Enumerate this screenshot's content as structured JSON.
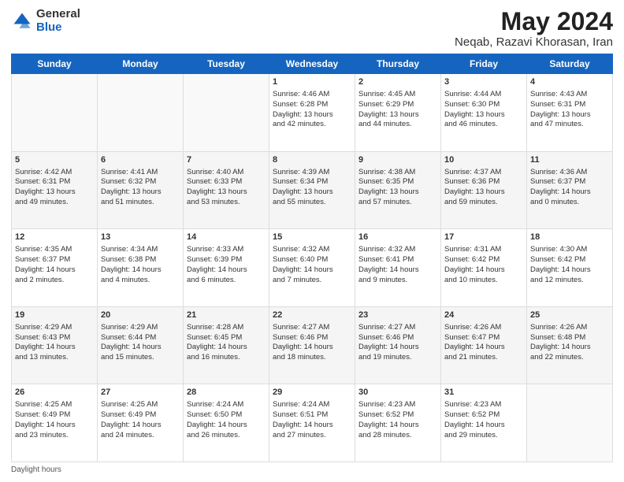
{
  "logo": {
    "general": "General",
    "blue": "Blue"
  },
  "title": "May 2024",
  "subtitle": "Neqab, Razavi Khorasan, Iran",
  "days_of_week": [
    "Sunday",
    "Monday",
    "Tuesday",
    "Wednesday",
    "Thursday",
    "Friday",
    "Saturday"
  ],
  "footer_label": "Daylight hours",
  "weeks": [
    [
      {
        "day": "",
        "info": ""
      },
      {
        "day": "",
        "info": ""
      },
      {
        "day": "",
        "info": ""
      },
      {
        "day": "1",
        "info": "Sunrise: 4:46 AM\nSunset: 6:28 PM\nDaylight: 13 hours\nand 42 minutes."
      },
      {
        "day": "2",
        "info": "Sunrise: 4:45 AM\nSunset: 6:29 PM\nDaylight: 13 hours\nand 44 minutes."
      },
      {
        "day": "3",
        "info": "Sunrise: 4:44 AM\nSunset: 6:30 PM\nDaylight: 13 hours\nand 46 minutes."
      },
      {
        "day": "4",
        "info": "Sunrise: 4:43 AM\nSunset: 6:31 PM\nDaylight: 13 hours\nand 47 minutes."
      }
    ],
    [
      {
        "day": "5",
        "info": "Sunrise: 4:42 AM\nSunset: 6:31 PM\nDaylight: 13 hours\nand 49 minutes."
      },
      {
        "day": "6",
        "info": "Sunrise: 4:41 AM\nSunset: 6:32 PM\nDaylight: 13 hours\nand 51 minutes."
      },
      {
        "day": "7",
        "info": "Sunrise: 4:40 AM\nSunset: 6:33 PM\nDaylight: 13 hours\nand 53 minutes."
      },
      {
        "day": "8",
        "info": "Sunrise: 4:39 AM\nSunset: 6:34 PM\nDaylight: 13 hours\nand 55 minutes."
      },
      {
        "day": "9",
        "info": "Sunrise: 4:38 AM\nSunset: 6:35 PM\nDaylight: 13 hours\nand 57 minutes."
      },
      {
        "day": "10",
        "info": "Sunrise: 4:37 AM\nSunset: 6:36 PM\nDaylight: 13 hours\nand 59 minutes."
      },
      {
        "day": "11",
        "info": "Sunrise: 4:36 AM\nSunset: 6:37 PM\nDaylight: 14 hours\nand 0 minutes."
      }
    ],
    [
      {
        "day": "12",
        "info": "Sunrise: 4:35 AM\nSunset: 6:37 PM\nDaylight: 14 hours\nand 2 minutes."
      },
      {
        "day": "13",
        "info": "Sunrise: 4:34 AM\nSunset: 6:38 PM\nDaylight: 14 hours\nand 4 minutes."
      },
      {
        "day": "14",
        "info": "Sunrise: 4:33 AM\nSunset: 6:39 PM\nDaylight: 14 hours\nand 6 minutes."
      },
      {
        "day": "15",
        "info": "Sunrise: 4:32 AM\nSunset: 6:40 PM\nDaylight: 14 hours\nand 7 minutes."
      },
      {
        "day": "16",
        "info": "Sunrise: 4:32 AM\nSunset: 6:41 PM\nDaylight: 14 hours\nand 9 minutes."
      },
      {
        "day": "17",
        "info": "Sunrise: 4:31 AM\nSunset: 6:42 PM\nDaylight: 14 hours\nand 10 minutes."
      },
      {
        "day": "18",
        "info": "Sunrise: 4:30 AM\nSunset: 6:42 PM\nDaylight: 14 hours\nand 12 minutes."
      }
    ],
    [
      {
        "day": "19",
        "info": "Sunrise: 4:29 AM\nSunset: 6:43 PM\nDaylight: 14 hours\nand 13 minutes."
      },
      {
        "day": "20",
        "info": "Sunrise: 4:29 AM\nSunset: 6:44 PM\nDaylight: 14 hours\nand 15 minutes."
      },
      {
        "day": "21",
        "info": "Sunrise: 4:28 AM\nSunset: 6:45 PM\nDaylight: 14 hours\nand 16 minutes."
      },
      {
        "day": "22",
        "info": "Sunrise: 4:27 AM\nSunset: 6:46 PM\nDaylight: 14 hours\nand 18 minutes."
      },
      {
        "day": "23",
        "info": "Sunrise: 4:27 AM\nSunset: 6:46 PM\nDaylight: 14 hours\nand 19 minutes."
      },
      {
        "day": "24",
        "info": "Sunrise: 4:26 AM\nSunset: 6:47 PM\nDaylight: 14 hours\nand 21 minutes."
      },
      {
        "day": "25",
        "info": "Sunrise: 4:26 AM\nSunset: 6:48 PM\nDaylight: 14 hours\nand 22 minutes."
      }
    ],
    [
      {
        "day": "26",
        "info": "Sunrise: 4:25 AM\nSunset: 6:49 PM\nDaylight: 14 hours\nand 23 minutes."
      },
      {
        "day": "27",
        "info": "Sunrise: 4:25 AM\nSunset: 6:49 PM\nDaylight: 14 hours\nand 24 minutes."
      },
      {
        "day": "28",
        "info": "Sunrise: 4:24 AM\nSunset: 6:50 PM\nDaylight: 14 hours\nand 26 minutes."
      },
      {
        "day": "29",
        "info": "Sunrise: 4:24 AM\nSunset: 6:51 PM\nDaylight: 14 hours\nand 27 minutes."
      },
      {
        "day": "30",
        "info": "Sunrise: 4:23 AM\nSunset: 6:52 PM\nDaylight: 14 hours\nand 28 minutes."
      },
      {
        "day": "31",
        "info": "Sunrise: 4:23 AM\nSunset: 6:52 PM\nDaylight: 14 hours\nand 29 minutes."
      },
      {
        "day": "",
        "info": ""
      }
    ]
  ]
}
